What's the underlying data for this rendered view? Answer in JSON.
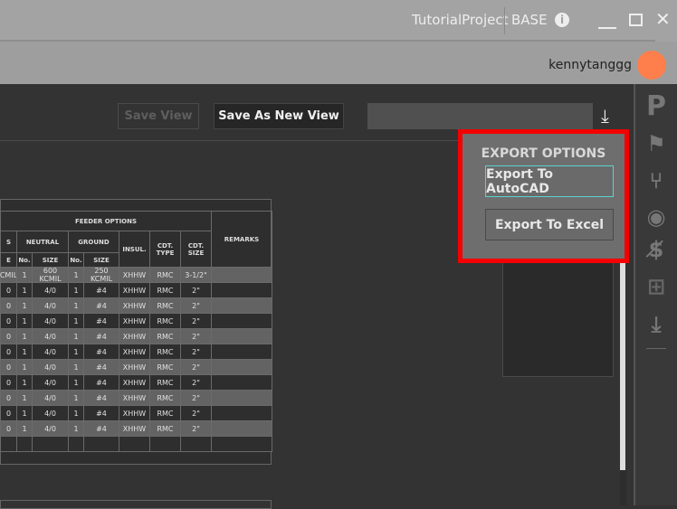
{
  "titlebar": {
    "project": "TutorialProject",
    "mode": "BASE"
  },
  "user": {
    "name": "kennytanggg",
    "avatar_color": "#fe7f4c"
  },
  "toolbar": {
    "save_view": "Save View",
    "save_as_new_view": "Save As New View",
    "view_name_value": ""
  },
  "export": {
    "title": "EXPORT OPTIONS",
    "autocad": "Export To AutoCAD",
    "excel": "Export To Excel",
    "highlight_color": "#f40000"
  },
  "table": {
    "group_header": "FEEDER OPTIONS",
    "remarks": "REMARKS",
    "groups": [
      "S",
      "NEUTRAL",
      "GROUND",
      "INSUL.",
      "CDT. TYPE",
      "CDT. SIZE"
    ],
    "sub": [
      "E",
      "No.",
      "SIZE",
      "No.",
      "SIZE"
    ],
    "rows": [
      [
        "CMIL",
        "1",
        "600 KCMIL",
        "1",
        "250 KCMIL",
        "XHHW",
        "RMC",
        "3-1/2\"",
        ""
      ],
      [
        "0",
        "1",
        "4/0",
        "1",
        "#4",
        "XHHW",
        "RMC",
        "2\"",
        ""
      ],
      [
        "0",
        "1",
        "4/0",
        "1",
        "#4",
        "XHHW",
        "RMC",
        "2\"",
        ""
      ],
      [
        "0",
        "1",
        "4/0",
        "1",
        "#4",
        "XHHW",
        "RMC",
        "2\"",
        ""
      ],
      [
        "0",
        "1",
        "4/0",
        "1",
        "#4",
        "XHHW",
        "RMC",
        "2\"",
        ""
      ],
      [
        "0",
        "1",
        "4/0",
        "1",
        "#4",
        "XHHW",
        "RMC",
        "2\"",
        ""
      ],
      [
        "0",
        "1",
        "4/0",
        "1",
        "#4",
        "XHHW",
        "RMC",
        "2\"",
        ""
      ],
      [
        "0",
        "1",
        "4/0",
        "1",
        "#4",
        "XHHW",
        "RMC",
        "2\"",
        ""
      ],
      [
        "0",
        "1",
        "4/0",
        "1",
        "#4",
        "XHHW",
        "RMC",
        "2\"",
        ""
      ],
      [
        "0",
        "1",
        "4/0",
        "1",
        "#4",
        "XHHW",
        "RMC",
        "2\"",
        ""
      ],
      [
        "0",
        "1",
        "4/0",
        "1",
        "#4",
        "XHHW",
        "RMC",
        "2\"",
        ""
      ],
      [
        "",
        "",
        "",
        "",
        "",
        "",
        "",
        "",
        ""
      ]
    ]
  }
}
